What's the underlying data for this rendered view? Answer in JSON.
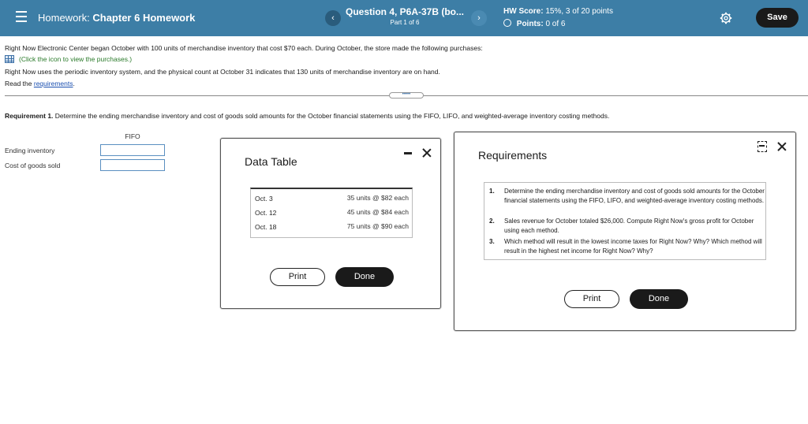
{
  "header": {
    "hw_label": "Homework:",
    "hw_name": "Chapter 6 Homework",
    "question_title": "Question 4, P6A-37B (bo...",
    "question_part": "Part 1 of 6",
    "prev_glyph": "‹",
    "next_glyph": "›",
    "score_label": "HW Score:",
    "score_value": "15%, 3 of 20 points",
    "points_label": "Points:",
    "points_value": "0 of 6",
    "save_label": "Save",
    "menu_icon": "hamburger-menu-icon",
    "settings_icon": "gear-icon"
  },
  "problem": {
    "line1": "Right Now Electronic Center began October with 100 units of merchandise inventory that cost $70 each. During October, the store made the following purchases:",
    "click_text": "(Click the icon to view the purchases.)",
    "line3": "Right Now uses the periodic inventory system, and the physical count at October 31 indicates that 130 units of merchandise inventory are on hand.",
    "read_prefix": "Read the ",
    "read_link": "requirements",
    "read_suffix": ".",
    "expand_glyph": "•••••",
    "req1_bold": "Requirement 1.",
    "req1_text": " Determine the ending merchandise inventory and cost of goods sold amounts for the October financial statements using the FIFO, LIFO, and weighted-average inventory costing methods."
  },
  "answer_table": {
    "column_header": "FIFO",
    "rows": [
      {
        "label": "Ending inventory",
        "value": ""
      },
      {
        "label": "Cost of goods sold",
        "value": ""
      }
    ]
  },
  "data_table_modal": {
    "title": "Data Table",
    "rows": [
      {
        "date": "Oct. 3",
        "value": "35 units @ $82 each"
      },
      {
        "date": "Oct. 12",
        "value": "45 units @ $84 each"
      },
      {
        "date": "Oct. 18",
        "value": "75 units @ $90 each"
      }
    ],
    "print_label": "Print",
    "done_label": "Done"
  },
  "requirements_modal": {
    "title": "Requirements",
    "items": [
      {
        "num": "1.",
        "text": "Determine the ending merchandise inventory and cost of goods sold amounts for the October financial statements using the FIFO, LIFO, and weighted-average inventory costing methods."
      },
      {
        "num": "2.",
        "text": "Sales revenue for October totaled $26,000. Compute Right Now's gross profit for October using each method."
      },
      {
        "num": "3.",
        "text": "Which method will result in the lowest income taxes for Right Now? Why? Which method will result in the highest net income for Right Now? Why?"
      }
    ],
    "print_label": "Print",
    "done_label": "Done"
  }
}
